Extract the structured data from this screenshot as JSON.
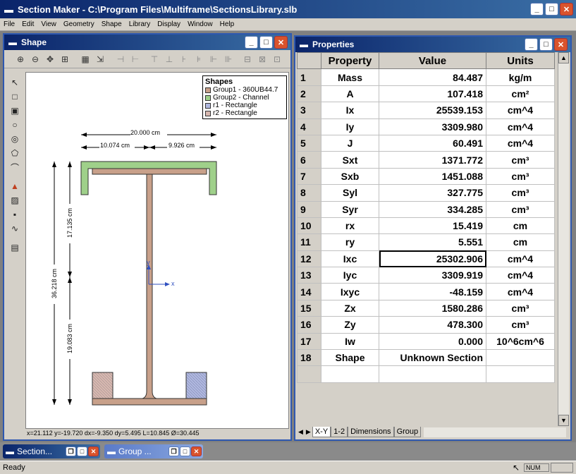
{
  "app": {
    "title": "Section Maker - C:\\Program Files\\Multiframe\\SectionsLibrary.slb",
    "menu": [
      "File",
      "Edit",
      "View",
      "Geometry",
      "Shape",
      "Library",
      "Display",
      "Window",
      "Help"
    ],
    "window_buttons": {
      "minimize": "_",
      "maximize": "□",
      "close": "✕"
    }
  },
  "shape_window": {
    "title": "Shape",
    "legend_title": "Shapes",
    "legend_items": [
      {
        "label": "Group1 - 360UB44.7",
        "color": "#c8a08a"
      },
      {
        "label": "Group2 - Channel",
        "color": "#9fd08a"
      },
      {
        "label": "r1 - Rectangle",
        "color": "#b0b8e0"
      },
      {
        "label": "r2 - Rectangle",
        "color": "#d8b8b0"
      }
    ],
    "dims": {
      "total_width": "20.000 cm",
      "left_width": "10.074 cm",
      "right_width": "9.926 cm",
      "total_height": "36.218 cm",
      "upper_height": "17.135 cm",
      "lower_height": "19.083 cm",
      "axis_x": "x",
      "axis_y": "y"
    },
    "status": "x=21.112 y=-19.720 dx=-9.350 dy=5.495 L=10.845 Ø=30.445"
  },
  "properties_window": {
    "title": "Properties",
    "headers": [
      "Property",
      "Value",
      "Units"
    ],
    "rows": [
      {
        "n": "1",
        "p": "Mass",
        "v": "84.487",
        "u": "kg/m"
      },
      {
        "n": "2",
        "p": "A",
        "v": "107.418",
        "u": "cm²"
      },
      {
        "n": "3",
        "p": "Ix",
        "v": "25539.153",
        "u": "cm^4"
      },
      {
        "n": "4",
        "p": "Iy",
        "v": "3309.980",
        "u": "cm^4"
      },
      {
        "n": "5",
        "p": "J",
        "v": "60.491",
        "u": "cm^4"
      },
      {
        "n": "6",
        "p": "Sxt",
        "v": "1371.772",
        "u": "cm³"
      },
      {
        "n": "7",
        "p": "Sxb",
        "v": "1451.088",
        "u": "cm³"
      },
      {
        "n": "8",
        "p": "Syl",
        "v": "327.775",
        "u": "cm³"
      },
      {
        "n": "9",
        "p": "Syr",
        "v": "334.285",
        "u": "cm³"
      },
      {
        "n": "10",
        "p": "rx",
        "v": "15.419",
        "u": "cm"
      },
      {
        "n": "11",
        "p": "ry",
        "v": "5.551",
        "u": "cm"
      },
      {
        "n": "12",
        "p": "Ixc",
        "v": "25302.906",
        "u": "cm^4"
      },
      {
        "n": "13",
        "p": "Iyc",
        "v": "3309.919",
        "u": "cm^4"
      },
      {
        "n": "14",
        "p": "Ixyc",
        "v": "-48.159",
        "u": "cm^4"
      },
      {
        "n": "15",
        "p": "Zx",
        "v": "1580.286",
        "u": "cm³"
      },
      {
        "n": "16",
        "p": "Zy",
        "v": "478.300",
        "u": "cm³"
      },
      {
        "n": "17",
        "p": "Iw",
        "v": "0.000",
        "u": "10^6cm^6"
      },
      {
        "n": "18",
        "p": "Shape",
        "v": "Unknown Section",
        "u": ""
      }
    ],
    "tabs": [
      "X-Y",
      "1-2",
      "Dimensions",
      "Group"
    ]
  },
  "taskbar": {
    "items": [
      {
        "label": "Section..."
      },
      {
        "label": "Group ..."
      }
    ]
  },
  "statusbar": {
    "left": "Ready",
    "num": "NUM"
  }
}
